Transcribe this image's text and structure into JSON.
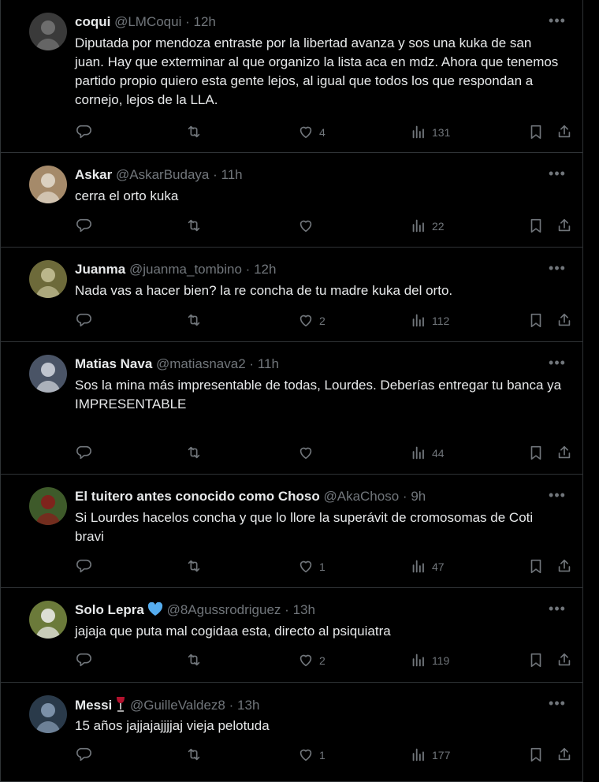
{
  "colors": {
    "background": "#000000",
    "text": "#e7e9ea",
    "muted": "#71767b",
    "border": "#2f3336",
    "verified": "#55acee"
  },
  "tweets": [
    {
      "name": "coqui",
      "handle": "@LMCoqui",
      "time": "12h",
      "badge": "",
      "text": "Diputada por mendoza entraste por la libertad avanza y sos una kuka de san juan. Hay que exterminar al que organizo la lista aca en mdz. Ahora que tenemos partido propio quiero esta gente lejos, al igual que todos los que respondan a cornejo, lejos de la LLA.",
      "likes": "4",
      "views": "131"
    },
    {
      "name": "Askar",
      "handle": "@AskarBudaya",
      "time": "11h",
      "badge": "",
      "text": "cerra el orto kuka",
      "likes": "",
      "views": "22"
    },
    {
      "name": "Juanma",
      "handle": "@juanma_tombino",
      "time": "12h",
      "badge": "",
      "text": "Nada vas a hacer bien? la re concha de tu madre kuka del orto.",
      "likes": "2",
      "views": "112"
    },
    {
      "name": "Matias Nava",
      "handle": "@matiasnava2",
      "time": "11h",
      "badge": "",
      "text": "Sos la mina más impresentable de todas, Lourdes. Deberías entregar tu banca ya\nIMPRESENTABLE",
      "likes": "",
      "views": "44"
    },
    {
      "name": "El tuitero antes conocido como Choso",
      "handle": "@AkaChoso",
      "time": "9h",
      "badge": "",
      "text": "Si Lourdes hacelos concha y que lo llore la superávit de cromosomas de Coti bravi",
      "likes": "1",
      "views": "47"
    },
    {
      "name": "Solo Lepra",
      "handle": "@8Agussrodriguez",
      "time": "13h",
      "badge": "blue-heart-emoji",
      "text": "jajaja que puta mal cogidaa esta, directo al psiquiatra",
      "likes": "2",
      "views": "119"
    },
    {
      "name": "Messi",
      "handle": "@GuilleValdez8",
      "time": "13h",
      "badge": "wine-glass-emoji",
      "text": "15 años jajjajajjjjaj vieja pelotuda",
      "likes": "1",
      "views": "177"
    }
  ],
  "ui": {
    "separator": "·",
    "more": "•••"
  }
}
